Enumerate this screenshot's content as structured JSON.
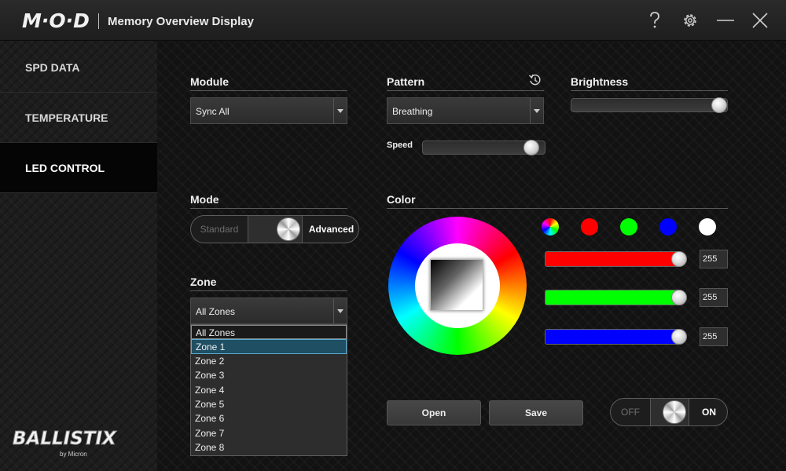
{
  "titlebar": {
    "logo": "M·O·D",
    "title": "Memory Overview Display"
  },
  "sidebar": {
    "items": [
      {
        "label": "SPD DATA"
      },
      {
        "label": "TEMPERATURE"
      },
      {
        "label": "LED CONTROL"
      }
    ],
    "active": "LED CONTROL",
    "brand": {
      "main": "BALLISTIX",
      "sub": "by Micron"
    }
  },
  "module": {
    "label": "Module",
    "value": "Sync All"
  },
  "pattern": {
    "label": "Pattern",
    "value": "Breathing"
  },
  "brightness": {
    "label": "Brightness",
    "level": 1.0
  },
  "speed": {
    "label": "Speed",
    "level": 0.9
  },
  "mode": {
    "label": "Mode",
    "left": "Standard",
    "right": "Advanced",
    "selected": "Advanced"
  },
  "zone": {
    "label": "Zone",
    "value": "All Zones",
    "options": [
      "All Zones",
      "Zone 1",
      "Zone 2",
      "Zone 3",
      "Zone 4",
      "Zone 5",
      "Zone 6",
      "Zone 7",
      "Zone 8"
    ],
    "highlighted": "Zone 1"
  },
  "color": {
    "label": "Color",
    "swatches": [
      "rainbow",
      "#ff0000",
      "#00ff00",
      "#0000ff",
      "#ffffff"
    ],
    "red": {
      "value": "255",
      "color": "#ff0000"
    },
    "green": {
      "value": "255",
      "color": "#00ff00"
    },
    "blue": {
      "value": "255",
      "color": "#0000ff"
    }
  },
  "actions": {
    "open": "Open",
    "save": "Save"
  },
  "power": {
    "off": "OFF",
    "on": "ON",
    "state": "ON"
  }
}
